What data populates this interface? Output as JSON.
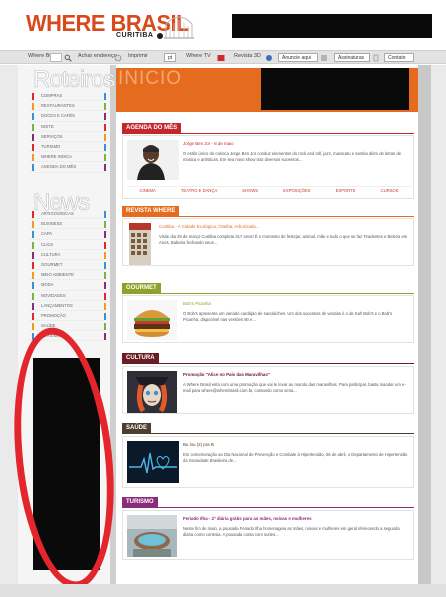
{
  "header": {
    "logo_main": "WHERE BRASIL",
    "logo_sub": "CURITIBA"
  },
  "toolbar": {
    "search_label": "Where Busc",
    "address_label": "Achar endereço",
    "print_label": "Imprimir",
    "lang_box": "pt",
    "tv_label": "Where TV",
    "magazine_label": "Revista 3D",
    "ad_label": "Anuncie aqui",
    "subscribe_label": "Assinaturas",
    "contact_label": "Contato"
  },
  "sidebar": {
    "roteiros_heading": "Roteiros",
    "roteiros_items": [
      "COMPRAS",
      "RESTAURANTES",
      "DOCES E CAFÉS",
      "NOITE",
      "SERVIÇOS",
      "TURISMO",
      "WHERE INDICA",
      "AGENDA DO MÊS"
    ],
    "news_heading": "News",
    "news_items": [
      "ARTIGOS/DICAS",
      "BUSINESS",
      "CAPA",
      "CLICK",
      "CULTURA",
      "GOURMET",
      "MEIO AMBIENTE",
      "MODA",
      "NOVIDADES",
      "LANÇAMENTOS",
      "PROMOÇÃO",
      "SAÚDE",
      "TURISMO"
    ]
  },
  "main": {
    "inicio": "INICIO",
    "agenda": {
      "label": "AGENDA DO MÊS",
      "title": "Jorge Ben Jor - 8 de maio",
      "text": "O estilo único do carioca Jorge Ben Jor conduz elementos do rock and roll, jazz, maracatu e samba além de letras de música e artísticas. Em seu novo show traz diversos sucessos...",
      "categories": [
        "CINEMA",
        "TEATRO E DANÇA",
        "SHOWS",
        "EXPOSIÇÕES",
        "ESPORTE",
        "CURSOS"
      ]
    },
    "revista": {
      "label": "REVISTA WHERE",
      "title": "Curitiba - A Cidade Ecológica, Ovelha, Arborizada...",
      "text": "Visite dia 29 de março Curitiba completa 317 anos! É o momento de festejar, animal, mãe e tudo o que se faz Tiradentes e Beleza em Anos, Babeira fechando seus..."
    },
    "gourmet": {
      "label": "GOURMET",
      "title": "Bob's Picanha",
      "text": "O Bob's apresenta um variado cardápio de sanduíches. Um dos sucessos de vendas é o de Kal! Bob's e o Bob's Picanha, disponível nas versões 90 e..."
    },
    "cultura": {
      "label": "CULTURA",
      "title": "Promoção \"Alice no País das Maravilhas\"",
      "text": "A Where Brasil está com uma promoção que vai te levar ao mundo das maravilhas. Para participar, basta mandar um e-mail para where@wherebrasil.com.br, contando como seria..."
    },
    "saude": {
      "label": "SAÚDE",
      "title": "Bu lou (2) pra B",
      "text": "Em comemoração ao Dia Nacional de Prevenção e Combate à Hipertensão, 26 de abril, o Departamento de Hipertensão da Sociedade Brasileira de..."
    },
    "turismo": {
      "label": "TURISMO",
      "title": "Feriado Ilha - 2ª diária grátis para as mães, noivas e mulheres",
      "text": "Neste fim de maio, a pousada Feriado Ilha homenageia as mães, noivas e mulheres em geral oferecendo a segunda diária como cortesia. A pousada conta com suítes..."
    }
  },
  "colors": {
    "orange": "#e56b1e",
    "agenda": "#c5282c",
    "revista": "#e56b1e",
    "gourmet": "#8fa12a",
    "cultura": "#6b1d24",
    "saude": "#4e3e2d",
    "turismo": "#8b2c7a",
    "oval": "#e3262b"
  }
}
